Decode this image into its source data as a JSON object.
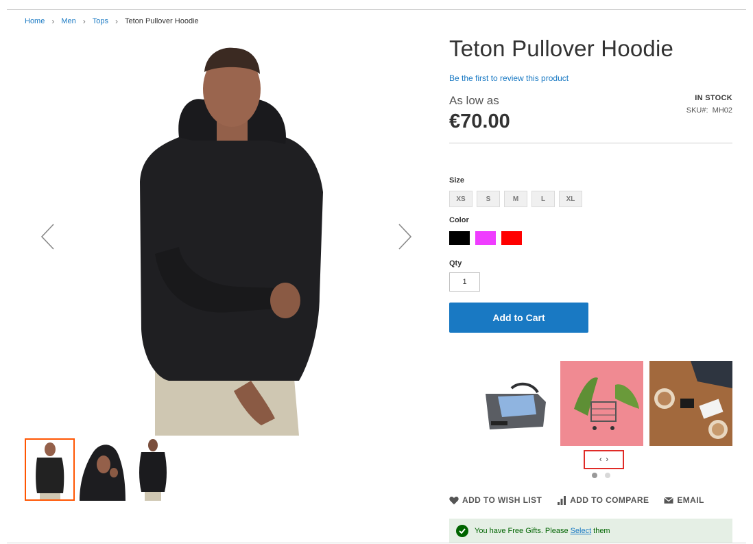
{
  "breadcrumb": {
    "items": [
      "Home",
      "Men",
      "Tops"
    ],
    "current": "Teton Pullover Hoodie"
  },
  "product": {
    "title": "Teton Pullover Hoodie",
    "review_link": "Be the first to review this product",
    "price_prefix": "As low as",
    "price": "€70.00",
    "stock": "IN STOCK",
    "sku_label": "SKU#:",
    "sku": "MH02"
  },
  "options": {
    "size_label": "Size",
    "sizes": [
      "XS",
      "S",
      "M",
      "L",
      "XL"
    ],
    "color_label": "Color",
    "colors": [
      "#000000",
      "#ef3dff",
      "#ff0000"
    ],
    "qty_label": "Qty",
    "qty_value": "1"
  },
  "add_to_cart": "Add to Cart",
  "related": {
    "items": [
      "messenger-bag",
      "toy-dinosaurs-shopping-cart",
      "desk-laptop-coffee"
    ],
    "nav_prev": "‹",
    "nav_next": "›",
    "dots": 2,
    "active_dot": 0
  },
  "actions": {
    "wishlist": "ADD TO WISH LIST",
    "compare": "ADD TO COMPARE",
    "email": "EMAIL"
  },
  "gift_message": {
    "before": "You have Free Gifts. Please",
    "link": "Select",
    "after": "them"
  },
  "colors": {
    "link": "#1979c3",
    "button": "#1979c3",
    "thumb_active": "#ff5501",
    "nav_highlight": "#e02b27",
    "success_bg": "#e5efe5",
    "success_text": "#006400"
  }
}
